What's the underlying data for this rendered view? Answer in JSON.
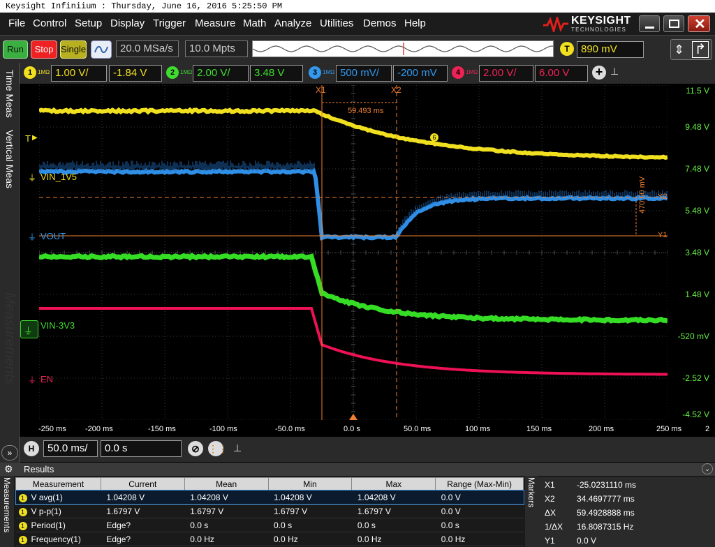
{
  "window_title": "Keysight Infiniium : Thursday, June 16, 2016 5:25:50 PM",
  "menu": [
    "File",
    "Control",
    "Setup",
    "Display",
    "Trigger",
    "Measure",
    "Math",
    "Analyze",
    "Utilities",
    "Demos",
    "Help"
  ],
  "logo": {
    "line1": "KEYSIGHT",
    "line2": "TECHNOLOGIES"
  },
  "toolbar": {
    "run": "Run",
    "stop": "Stop",
    "single": "Single",
    "sample_rate": "20.0 MSa/s",
    "memory_depth": "10.0 Mpts",
    "trigger_badge": "T",
    "trigger_level": "890 mV"
  },
  "channels": [
    {
      "num": "1",
      "coupling": "1MΩ",
      "scale": "1.00 V/",
      "offset": "-1.84 V",
      "color": "#f0e020"
    },
    {
      "num": "2",
      "coupling": "1MΩ",
      "scale": "2.00 V/",
      "offset": "3.48 V",
      "color": "#40dd30"
    },
    {
      "num": "3",
      "coupling": "1MΩ",
      "scale": "500 mV/",
      "offset": "-200 mV",
      "color": "#3399ee"
    },
    {
      "num": "4",
      "coupling": "1MΩ",
      "scale": "2.00 V/",
      "offset": "6.00 V",
      "color": "#ee2255"
    }
  ],
  "left_tabs": {
    "time_meas": "Time Meas",
    "vertical_meas": "Vertical Meas",
    "measurements": "Measurements"
  },
  "trace_labels": {
    "trigger": "T",
    "vin_1v5": "VIN_1V5",
    "vout": "VOUT",
    "vin_3v3": "VIN-3V3",
    "en": "EN"
  },
  "markers_on_plot": {
    "x1": "X1",
    "x2": "X2",
    "y1": "Y1",
    "y2": "Y2",
    "delta_x": "59.493 ms",
    "delta_y": "470.00 mV",
    "ch1_marker": "6"
  },
  "right_scale": [
    "11.5 V",
    "9.48 V",
    "7.48 V",
    "5.48 V",
    "3.48 V",
    "1.48 V",
    "-520 mV",
    "-2.52 V",
    "-4.52 V"
  ],
  "x_axis": [
    "-250 ms",
    "-200 ms",
    "-150 ms",
    "-100 ms",
    "-50.0 ms",
    "0.0 s",
    "50.0 ms",
    "100 ms",
    "150 ms",
    "200 ms",
    "250 ms"
  ],
  "x_axis_suffix": "2",
  "horizontal": {
    "badge": "H",
    "scale": "50.0 ms/",
    "position": "0.0 s"
  },
  "results": {
    "title": "Results",
    "side_label": "Measurements",
    "columns": [
      "Measurement",
      "Current",
      "Mean",
      "Min",
      "Max",
      "Range (Max-Min)"
    ],
    "rows": [
      {
        "ch": "1",
        "color": "#f0e020",
        "name": "V avg(1)",
        "current": "1.04208 V",
        "mean": "1.04208 V",
        "min": "1.04208 V",
        "max": "1.04208 V",
        "range": "0.0 V"
      },
      {
        "ch": "1",
        "color": "#f0e020",
        "name": "V p-p(1)",
        "current": "1.6797 V",
        "mean": "1.6797 V",
        "min": "1.6797 V",
        "max": "1.6797 V",
        "range": "0.0 V"
      },
      {
        "ch": "1",
        "color": "#f0e020",
        "name": "Period(1)",
        "current": "Edge?",
        "mean": "0.0 s",
        "min": "0.0 s",
        "max": "0.0 s",
        "range": "0.0 s"
      },
      {
        "ch": "1",
        "color": "#f0e020",
        "name": "Frequency(1)",
        "current": "Edge?",
        "mean": "0.0 Hz",
        "min": "0.0 Hz",
        "max": "0.0 Hz",
        "range": "0.0 Hz"
      }
    ]
  },
  "markers_panel": {
    "title": "Markers",
    "rows": [
      {
        "k": "X1",
        "v": "-25.0231110 ms"
      },
      {
        "k": "X2",
        "v": "34.4697777 ms"
      },
      {
        "k": "ΔX",
        "v": "59.4928888 ms"
      },
      {
        "k": "1/ΔX",
        "v": "16.8087315 Hz"
      },
      {
        "k": "Y1",
        "v": "0.0 V"
      }
    ]
  }
}
